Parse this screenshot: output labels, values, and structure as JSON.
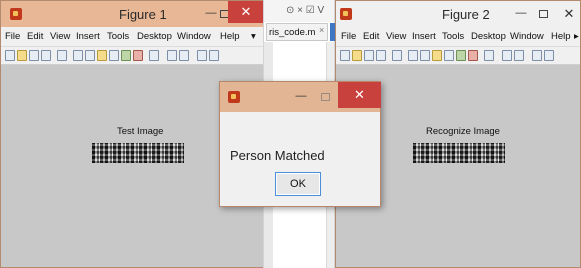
{
  "figure1": {
    "title": "Figure 1",
    "menu": [
      "File",
      "Edit",
      "View",
      "Insert",
      "Tools",
      "Desktop",
      "Window",
      "Help"
    ],
    "more_glyph": "▾",
    "image_label": "Test Image"
  },
  "figure2": {
    "title": "Figure 2",
    "menu": [
      "File",
      "Edit",
      "View",
      "Insert",
      "Tools",
      "Desktop",
      "Window",
      "Help"
    ],
    "more_glyph": "▸",
    "image_label": "Recognize Image"
  },
  "editor": {
    "top_glyphs": "⊙ × ☑ V",
    "tab_label": "ris_code.m",
    "tab_close": "×"
  },
  "dialog": {
    "message": "Person Matched",
    "ok_label": "OK"
  },
  "window_controls": {
    "minimize": "—",
    "close": "✕"
  },
  "colors": {
    "titlebar": "#e8b896",
    "close_button": "#c9413c",
    "figure_background": "#c8c8c8",
    "ok_border": "#4a8fd8"
  }
}
